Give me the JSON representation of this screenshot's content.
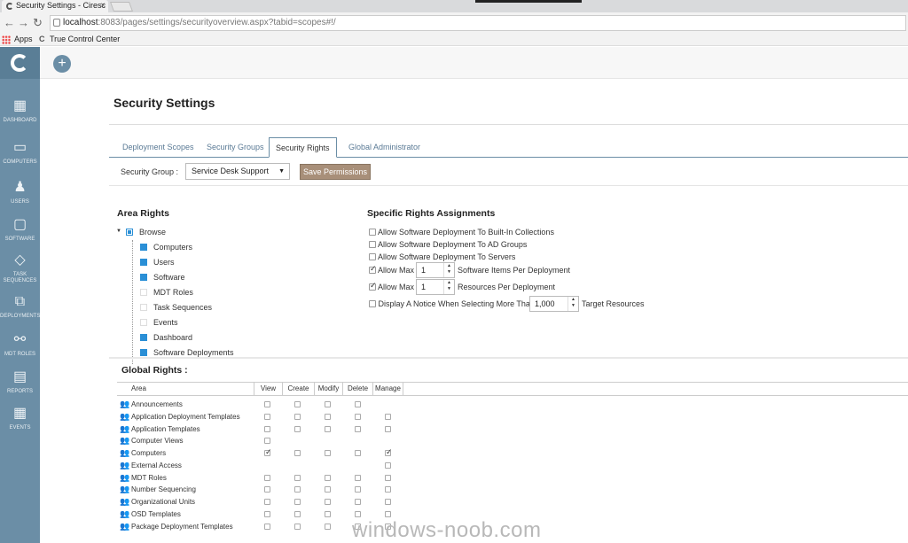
{
  "browser": {
    "tab_title": "Security Settings - Ciresc",
    "url_host": "localhost",
    "url_rest": ":8083/pages/settings/securityoverview.aspx?tabid=scopes#!/",
    "bookmarks": [
      "Apps",
      "True Control Center"
    ]
  },
  "sidebar": {
    "items": [
      {
        "label": "DASHBOARD",
        "icon": "dashboard-icon"
      },
      {
        "label": "COMPUTERS",
        "icon": "monitor-icon"
      },
      {
        "label": "USERS",
        "icon": "users-icon"
      },
      {
        "label": "SOFTWARE",
        "icon": "software-icon"
      },
      {
        "label": "TASK SEQUENCES",
        "icon": "layers-icon"
      },
      {
        "label": "DEPLOYMENTS",
        "icon": "deploy-icon"
      },
      {
        "label": "MDT ROLES",
        "icon": "share-icon"
      },
      {
        "label": "REPORTS",
        "icon": "reports-icon"
      },
      {
        "label": "EVENTS",
        "icon": "calendar-icon"
      }
    ]
  },
  "page": {
    "title": "Security Settings",
    "tabs": [
      "Deployment Scopes",
      "Security Groups",
      "Security Rights",
      "Global Administrator"
    ],
    "active_tab": "Security Rights",
    "security_group_label": "Security Group :",
    "security_group_value": "Service Desk Support",
    "save_label": "Save Permissions"
  },
  "area_rights": {
    "heading": "Area Rights",
    "root": "Browse",
    "items": [
      {
        "label": "Computers",
        "checked": true
      },
      {
        "label": "Users",
        "checked": true
      },
      {
        "label": "Software",
        "checked": true
      },
      {
        "label": "MDT Roles",
        "checked": false
      },
      {
        "label": "Task Sequences",
        "checked": false
      },
      {
        "label": "Events",
        "checked": false
      },
      {
        "label": "Dashboard",
        "checked": true
      },
      {
        "label": "Software Deployments",
        "checked": true
      }
    ]
  },
  "specific_rights": {
    "heading": "Specific Rights Assignments",
    "row1": "Allow Software Deployment To Built-In Collections",
    "row2": "Allow Software Deployment To AD Groups",
    "row3": "Allow Software Deployment To Servers",
    "row4_pre": "Allow Max",
    "row4_value": "1",
    "row4_post": "Software Items Per Deployment",
    "row5_pre": "Allow Max",
    "row5_value": "1",
    "row5_post": "Resources Per Deployment",
    "row6_pre": "Display A Notice When Selecting More Than",
    "row6_value": "1,000",
    "row6_post": "Target Resources",
    "checked": [
      false,
      false,
      false,
      true,
      true,
      false
    ]
  },
  "global_rights": {
    "heading": "Global Rights :",
    "columns": [
      "Area",
      "View",
      "Create",
      "Modify",
      "Delete",
      "Manage"
    ],
    "rows": [
      {
        "name": "Announcements",
        "cells": [
          0,
          0,
          0,
          0,
          null
        ]
      },
      {
        "name": "Application Deployment Templates",
        "cells": [
          0,
          0,
          0,
          0,
          0
        ]
      },
      {
        "name": "Application Templates",
        "cells": [
          0,
          0,
          0,
          0,
          0
        ]
      },
      {
        "name": "Computer Views",
        "cells": [
          0,
          null,
          null,
          null,
          null
        ]
      },
      {
        "name": "Computers",
        "cells": [
          1,
          0,
          0,
          0,
          1
        ]
      },
      {
        "name": "External Access",
        "cells": [
          null,
          null,
          null,
          null,
          0
        ]
      },
      {
        "name": "MDT Roles",
        "cells": [
          0,
          0,
          0,
          0,
          0
        ]
      },
      {
        "name": "Number Sequencing",
        "cells": [
          0,
          0,
          0,
          0,
          0
        ]
      },
      {
        "name": "Organizational Units",
        "cells": [
          0,
          0,
          0,
          0,
          0
        ]
      },
      {
        "name": "OSD Templates",
        "cells": [
          0,
          0,
          0,
          0,
          0
        ]
      },
      {
        "name": "Package Deployment Templates",
        "cells": [
          0,
          0,
          0,
          0,
          0
        ]
      }
    ]
  },
  "watermark": "windows-noob.com"
}
